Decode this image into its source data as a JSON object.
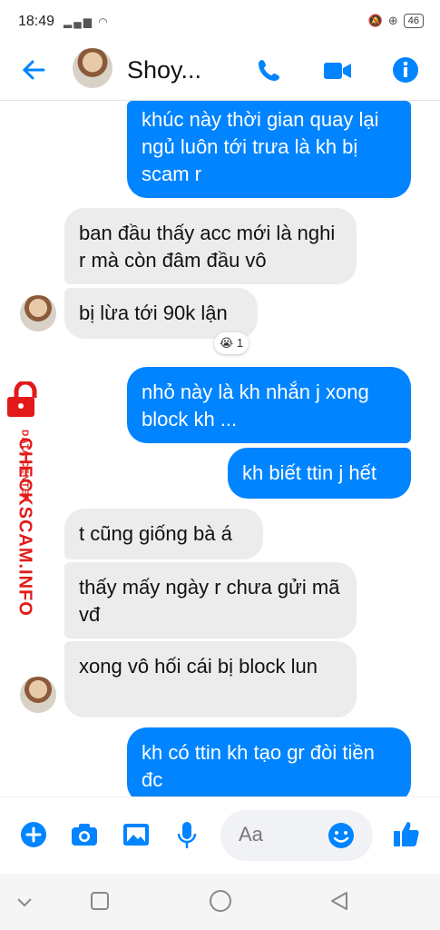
{
  "status_bar": {
    "time": "18:49",
    "battery": "46"
  },
  "header": {
    "contact_name": "Shoy..."
  },
  "messages": [
    {
      "dir": "out",
      "text": "khúc này thời gian quay lại ngủ luôn tới trưa là kh bị scam r"
    },
    {
      "dir": "in",
      "text": "ban đầu thấy acc mới là nghi r mà còn đâm đầu vô"
    },
    {
      "dir": "in",
      "text": "bị lừa tới 90k lận",
      "reaction": "😭",
      "reaction_count": "1"
    },
    {
      "dir": "out",
      "text": "nhỏ này là kh nhắn j xong block kh ..."
    },
    {
      "dir": "out",
      "text": "kh biết ttin j hết"
    },
    {
      "dir": "in",
      "text": "t cũng giống bà á"
    },
    {
      "dir": "in",
      "text": "thấy mấy ngày r chưa gửi mã vđ"
    },
    {
      "dir": "in",
      "text": "xong vô hối cái bị block lun"
    },
    {
      "dir": "out",
      "text": "kh có ttin kh tạo gr đòi tiền đc"
    }
  ],
  "watermark": {
    "main": "CHECKSCAM.INFO",
    "sub": "DATA CENTER"
  },
  "composer": {
    "placeholder": "Aa"
  },
  "colors": {
    "accent": "#0084ff",
    "incoming": "#ececec",
    "watermark": "#e21a1a"
  },
  "icons": [
    "back-arrow-icon",
    "phone-icon",
    "video-icon",
    "info-icon",
    "plus-icon",
    "camera-icon",
    "image-icon",
    "mic-icon",
    "emoji-icon",
    "like-icon"
  ]
}
